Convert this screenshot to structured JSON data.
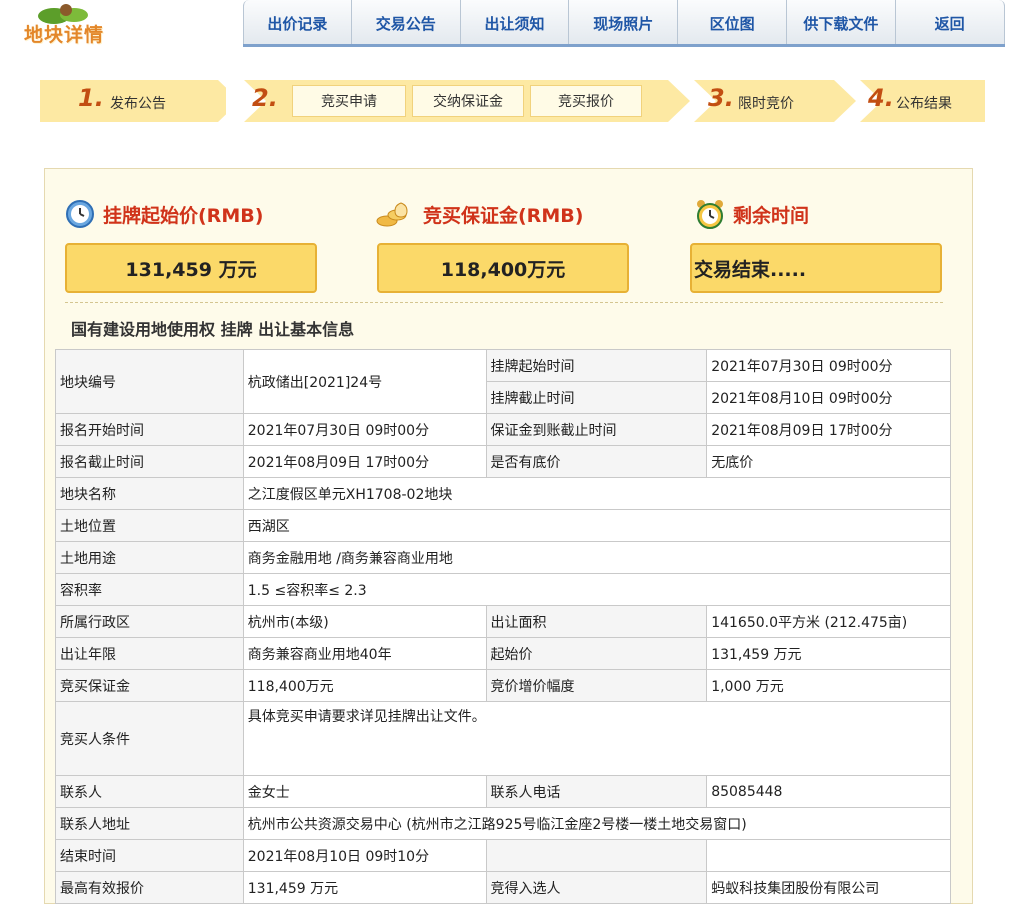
{
  "logo": {
    "text": "地块详情"
  },
  "nav": [
    "出价记录",
    "交易公告",
    "出让须知",
    "现场照片",
    "区位图",
    "供下载文件",
    "返回"
  ],
  "steps": {
    "s1": {
      "num": "1.",
      "label": "发布公告"
    },
    "s2": {
      "num": "2.",
      "sub": [
        "竞买申请",
        "交纳保证金",
        "竞买报价"
      ]
    },
    "s3": {
      "num": "3.",
      "label": "限时竞价"
    },
    "s4": {
      "num": "4.",
      "label": "公布结果"
    }
  },
  "indicators": {
    "start_price": {
      "label": "挂牌起始价(RMB)",
      "value": "131,459 万元"
    },
    "deposit": {
      "label": "竞买保证金(RMB)",
      "value": "118,400万元"
    },
    "remaining": {
      "label": "剩余时间",
      "value": "交易结束....."
    }
  },
  "section_title": "国有建设用地使用权 挂牌 出让基本信息",
  "table": {
    "r1": {
      "label": "地块编号",
      "value": "杭政储出[2021]24号",
      "sub1_label": "挂牌起始时间",
      "sub1_value": "2021年07月30日 09时00分",
      "sub2_label": "挂牌截止时间",
      "sub2_value": "2021年08月10日 09时00分"
    },
    "r2": {
      "l1": "报名开始时间",
      "v1": "2021年07月30日 09时00分",
      "l2": "保证金到账截止时间",
      "v2": "2021年08月09日 17时00分"
    },
    "r3": {
      "l1": "报名截止时间",
      "v1": "2021年08月09日 17时00分",
      "l2": "是否有底价",
      "v2": "无底价"
    },
    "r4": {
      "l1": "地块名称",
      "v1": "之江度假区单元XH1708-02地块"
    },
    "r5": {
      "l1": "土地位置",
      "v1": "西湖区"
    },
    "r6": {
      "l1": "土地用途",
      "v1": "商务金融用地 /商务兼容商业用地"
    },
    "r7": {
      "l1": "容积率",
      "v1": "1.5 ≤容积率≤ 2.3"
    },
    "r8": {
      "l1": "所属行政区",
      "v1": "杭州市(本级)",
      "l2": "出让面积",
      "v2": "141650.0平方米 (212.475亩)"
    },
    "r9": {
      "l1": "出让年限",
      "v1": "商务兼容商业用地40年",
      "l2": "起始价",
      "v2": "131,459 万元"
    },
    "r10": {
      "l1": "竞买保证金",
      "v1": "118,400万元",
      "l2": "竞价增价幅度",
      "v2": "1,000 万元"
    },
    "r11": {
      "l1": "竞买人条件",
      "v1": "具体竞买申请要求详见挂牌出让文件。"
    },
    "r12": {
      "l1": "联系人",
      "v1": "金女士",
      "l2": "联系人电话",
      "v2": "85085448"
    },
    "r13": {
      "l1": "联系人地址",
      "v1": "杭州市公共资源交易中心 (杭州市之江路925号临江金座2号楼一楼土地交易窗口)"
    },
    "r14": {
      "l1": "结束时间",
      "v1": "2021年08月10日 09时10分"
    },
    "r15": {
      "l1": "最高有效报价",
      "v1": "131,459 万元",
      "l2": "竞得入选人",
      "v2": "蚂蚁科技集团股份有限公司"
    }
  }
}
